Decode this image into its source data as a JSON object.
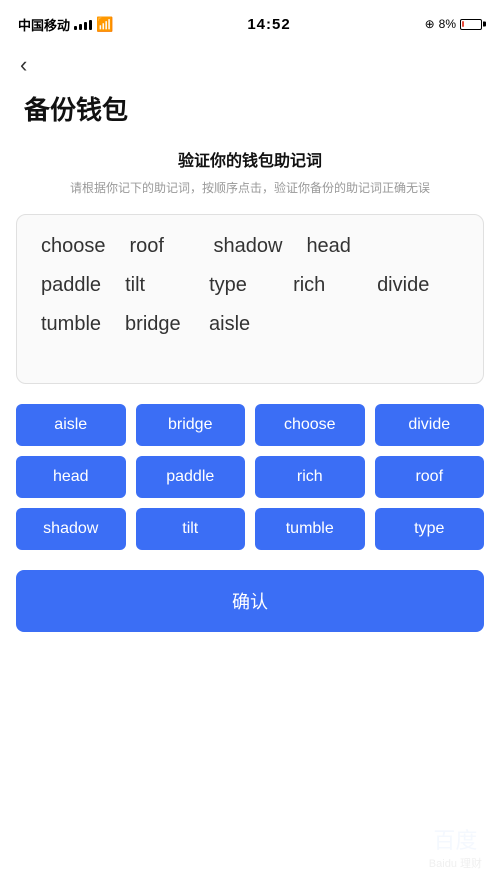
{
  "statusBar": {
    "carrier": "中国移动",
    "time": "14:52",
    "battery": "8%",
    "batteryPercent": 8
  },
  "nav": {
    "backIcon": "‹"
  },
  "page": {
    "title": "备份钱包",
    "sectionTitle": "验证你的钱包助记词",
    "sectionDesc": "请根据你记下的助记词，按顺序点击，验证你备份的助记词正确无误"
  },
  "displayWords": {
    "row1": [
      "choose",
      "roof",
      "shadow",
      "head"
    ],
    "row2": [
      "paddle",
      "tilt",
      "type",
      "rich",
      "divide"
    ],
    "row3": [
      "tumble",
      "bridge",
      "aisle"
    ]
  },
  "chips": [
    "aisle",
    "bridge",
    "choose",
    "divide",
    "head",
    "paddle",
    "rich",
    "roof",
    "shadow",
    "tilt",
    "tumble",
    "type"
  ],
  "confirmButton": {
    "label": "确认"
  }
}
